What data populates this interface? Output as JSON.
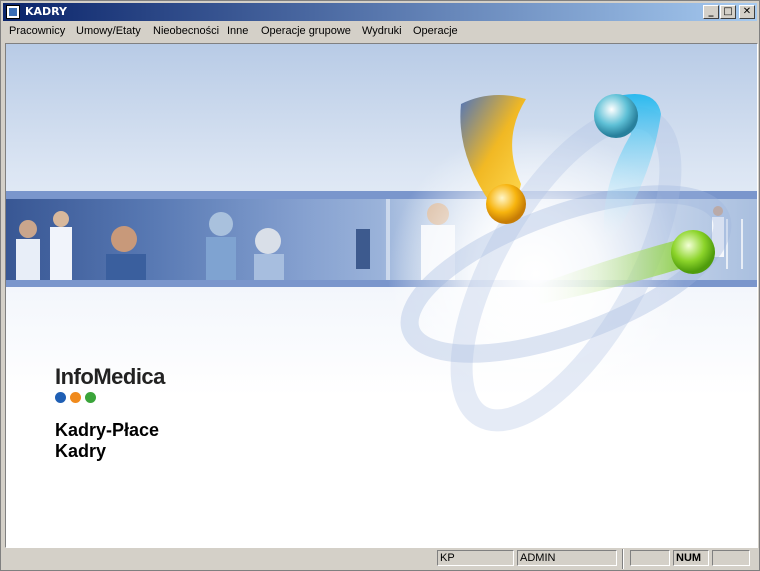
{
  "window": {
    "title": "KADRY",
    "minimize_glyph": "_",
    "maximize_glyph": "□",
    "close_glyph": "✕"
  },
  "menu": {
    "items": [
      {
        "label": "Pracownicy"
      },
      {
        "label": "Umowy/Etaty"
      },
      {
        "label": "Nieobecności"
      },
      {
        "label": "Inne"
      },
      {
        "label": "Operacje grupowe"
      },
      {
        "label": "Wydruki"
      },
      {
        "label": "Operacje"
      }
    ]
  },
  "splash": {
    "logo": "InfoMedica",
    "logo_dot_colors": [
      "#1f5fb4",
      "#f08a1c",
      "#3aa43a"
    ],
    "product_line1": "Kadry-Płace",
    "product_line2": "Kadry"
  },
  "statusbar": {
    "panel1": "KP",
    "panel2": "ADMIN",
    "panel3": "",
    "panel4": "NUM",
    "panel5": ""
  },
  "colors": {
    "titlebar_start": "#0a246a",
    "titlebar_end": "#a6caf0",
    "band": "#7a96cc"
  }
}
